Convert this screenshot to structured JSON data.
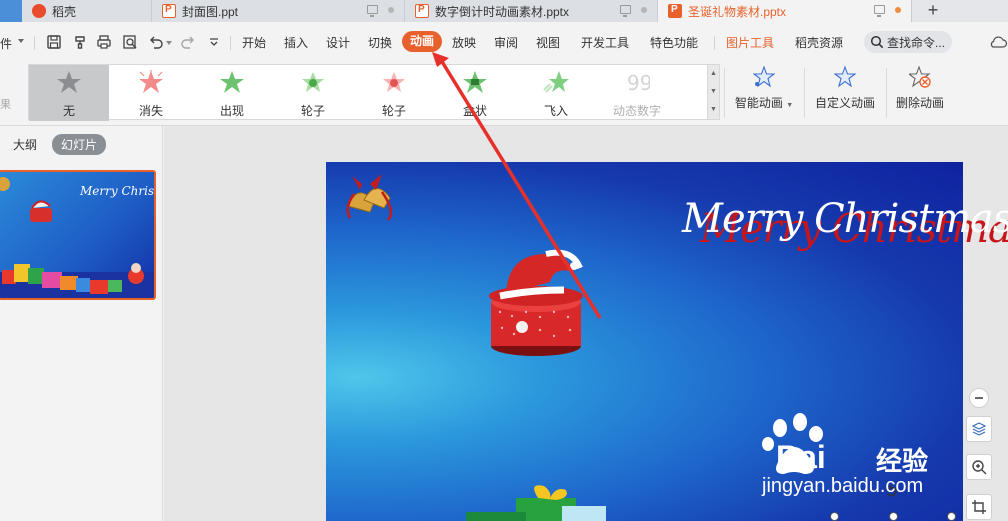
{
  "tabs": [
    {
      "title": "稻壳",
      "icon": "wps-logo-icon"
    },
    {
      "title": "封面图.ppt",
      "icon": "ppt-file-icon"
    },
    {
      "title": "数字倒计时动画素材.pptx",
      "icon": "ppt-file-icon"
    },
    {
      "title": "圣诞礼物素材.pptx",
      "icon": "ppt-file-icon",
      "active": true
    }
  ],
  "menu": {
    "file_label": "件",
    "items": [
      "开始",
      "插入",
      "设计",
      "切换",
      "动画",
      "放映",
      "审阅",
      "视图",
      "开发工具",
      "特色功能",
      "图片工具",
      "稻壳资源"
    ],
    "active_item": "动画",
    "highlight_item": "图片工具",
    "search_label": "查找命令..."
  },
  "ribbon": {
    "effects_label": "果",
    "gallery": [
      {
        "label": "无",
        "icon": "star-none-icon",
        "selected": true
      },
      {
        "label": "消失",
        "icon": "star-disappear-icon"
      },
      {
        "label": "出现",
        "icon": "star-appear-icon"
      },
      {
        "label": "轮子",
        "icon": "wheel-green-icon"
      },
      {
        "label": "轮子",
        "icon": "wheel-red-icon"
      },
      {
        "label": "盒状",
        "icon": "box-icon"
      },
      {
        "label": "飞入",
        "icon": "fly-in-icon"
      },
      {
        "label": "动态数字",
        "icon": "dynamic-number-icon",
        "disabled": true
      }
    ],
    "buttons": [
      {
        "label": "智能动画",
        "icon": "smart-animation-icon",
        "has_dropdown": true
      },
      {
        "label": "自定义动画",
        "icon": "custom-animation-icon"
      },
      {
        "label": "删除动画",
        "icon": "delete-animation-icon"
      }
    ]
  },
  "left_pane": {
    "tabs": [
      "大纲",
      "幻灯片"
    ],
    "active_tab": "幻灯片",
    "thumbnail_title": "Merry Christmas"
  },
  "slide": {
    "title": "Merry Christmas"
  },
  "watermark": {
    "brand_latin": "Bai",
    "brand_cn": "经验",
    "url": "jingyan.baidu.com"
  },
  "colors": {
    "accent": "#e8612c",
    "arrow": "#e8302a",
    "slide_dark": "#0f22a0",
    "slide_light": "#4fc6ea"
  }
}
